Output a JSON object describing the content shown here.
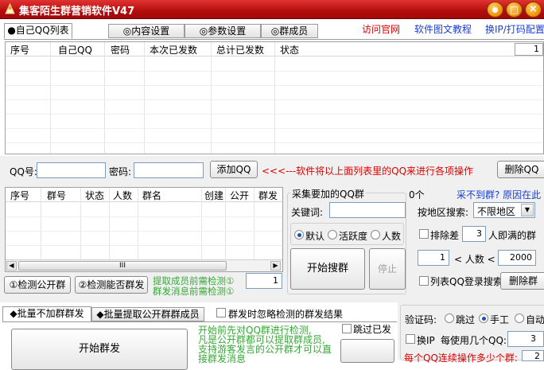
{
  "window": {
    "title": "集客陌生群营销软件V47",
    "min": "●",
    "max": "□",
    "close": "×"
  },
  "tabs": [
    {
      "label": "●自己QQ列表",
      "active": true
    },
    {
      "label": "◎内容设置"
    },
    {
      "label": "◎参数设置"
    },
    {
      "label": "◎群成员"
    }
  ],
  "links": {
    "official": "访问官网",
    "tutorial": "软件图文教程",
    "ip": "换IP/打码配置"
  },
  "qq_table": {
    "columns": [
      "序号",
      "自己QQ",
      "密码",
      "本次已发数",
      "总计已发数",
      "状态"
    ],
    "page": "1"
  },
  "qq_row": {
    "qq_label": "QQ号:",
    "qq_value": "",
    "pw_label": "密码:",
    "pw_value": "",
    "add_button": "添加QQ",
    "hint": "<<<---软件将以上面列表里的QQ来进行各项操作",
    "delete_button": "删除QQ"
  },
  "group_table": {
    "columns": [
      "序号",
      "群号",
      "状态",
      "人数",
      "群名",
      "创建",
      "公开",
      "群发"
    ],
    "scroll_label": "III"
  },
  "group_actions": {
    "check_public": "①检测公开群",
    "check_send": "②检测能否群发",
    "note1": "提取成员前需检测①",
    "note2": "群发消息前需检测①",
    "spin_value": "1"
  },
  "collect": {
    "title": "采集要加的QQ群",
    "count": "0个",
    "cannot_find": "采不到群? 原因在此",
    "keyword_label": "关键词:",
    "keyword_value": "",
    "radio_default": "默认",
    "radio_active": "活跃度",
    "radio_people": "人数",
    "start_search": "开始搜群",
    "stop": "停止",
    "region_label": "按地区搜索:",
    "region_value": "不限地区",
    "exclude_label": "排除差",
    "exclude_value": "3",
    "exclude_suffix": "人即满的群",
    "min_value": "1",
    "people_label": "< 人数 <",
    "max_value": "2000",
    "list_search": "列表QQ登录搜索",
    "delete_group": "删除群"
  },
  "bottom_tabs": [
    {
      "label": "◆批量不加群群发",
      "active": true
    },
    {
      "label": "◆批量提取公开群群成员"
    }
  ],
  "bottom": {
    "ignore_label": "群发时忽略检测的群发结果",
    "start_send": "开始群发",
    "info1": "开始前先对QQ群进行检测,",
    "info2": "凡是公开群都可以提取群成员,",
    "info3": "支持游客发言的公开群才可以直",
    "info4": "接群发消息",
    "skip_sent": "跳过已发"
  },
  "captcha": {
    "label": "验证码:",
    "skip": "跳过",
    "manual": "手工",
    "auto": "自动",
    "change_ip": "换IP",
    "per_qq_label": "每使用几个QQ:",
    "per_qq_value": "3",
    "continuous": "每个QQ连续操作多少个群:",
    "continuous_value": "2"
  }
}
